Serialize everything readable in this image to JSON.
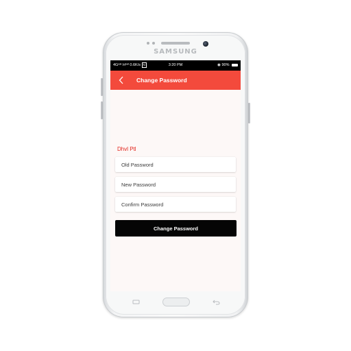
{
  "device": {
    "brand": "SAMSUNG"
  },
  "status_bar": {
    "left_indicators": "4Gᵉᵃᴵ Hᵉᵃᴵ 0.6K/s",
    "network_badge": "N",
    "time": "3:20 PM",
    "battery": "90%"
  },
  "toolbar": {
    "back_icon": "chevron-left-icon",
    "title": "Change Password"
  },
  "form": {
    "user_name": "Dhvl Ptl",
    "old_password_placeholder": "Old Password",
    "new_password_placeholder": "New Password",
    "confirm_password_placeholder": "Confirm Password",
    "submit_label": "Change Password"
  },
  "colors": {
    "accent": "#f34a3c",
    "user_name": "#e2231a",
    "button": "#050505",
    "screen_bg": "#fdf8f7"
  }
}
